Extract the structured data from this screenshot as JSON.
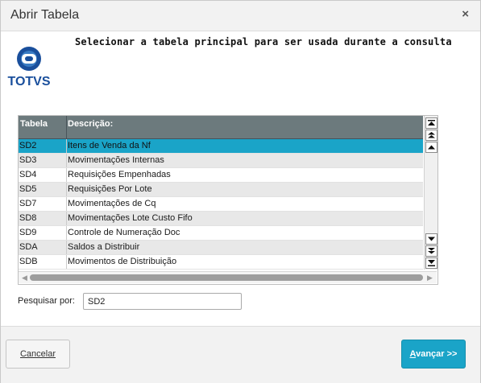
{
  "dialog": {
    "title": "Abrir Tabela",
    "close_glyph": "×",
    "heading": "Selecionar a tabela principal para ser usada durante a consulta",
    "logo": {
      "icon": "totvs-logo",
      "text": "TOTVS",
      "color": "#1a4f9c"
    }
  },
  "grid": {
    "columns": [
      "Tabela",
      "Descrição:"
    ],
    "selected_row": 0,
    "rows": [
      {
        "code": "SD2",
        "desc": "Itens de Venda da Nf"
      },
      {
        "code": "SD3",
        "desc": "Movimentações Internas"
      },
      {
        "code": "SD4",
        "desc": "Requisições Empenhadas"
      },
      {
        "code": "SD5",
        "desc": "Requisições Por Lote"
      },
      {
        "code": "SD7",
        "desc": "Movimentações de Cq"
      },
      {
        "code": "SD8",
        "desc": "Movimentações Lote Custo Fifo"
      },
      {
        "code": "SD9",
        "desc": "Controle de Numeração Doc"
      },
      {
        "code": "SDA",
        "desc": "Saldos a Distribuir"
      },
      {
        "code": "SDB",
        "desc": "Movimentos de Distribuição"
      }
    ]
  },
  "search": {
    "label": "Pesquisar por:",
    "value": "SD2"
  },
  "footer": {
    "cancel_label": "Cancelar",
    "next_label_underlined": "A",
    "next_label_rest": "vançar >>"
  },
  "colors": {
    "accent": "#1aa4c8",
    "header_bg": "#6c7a7d"
  }
}
